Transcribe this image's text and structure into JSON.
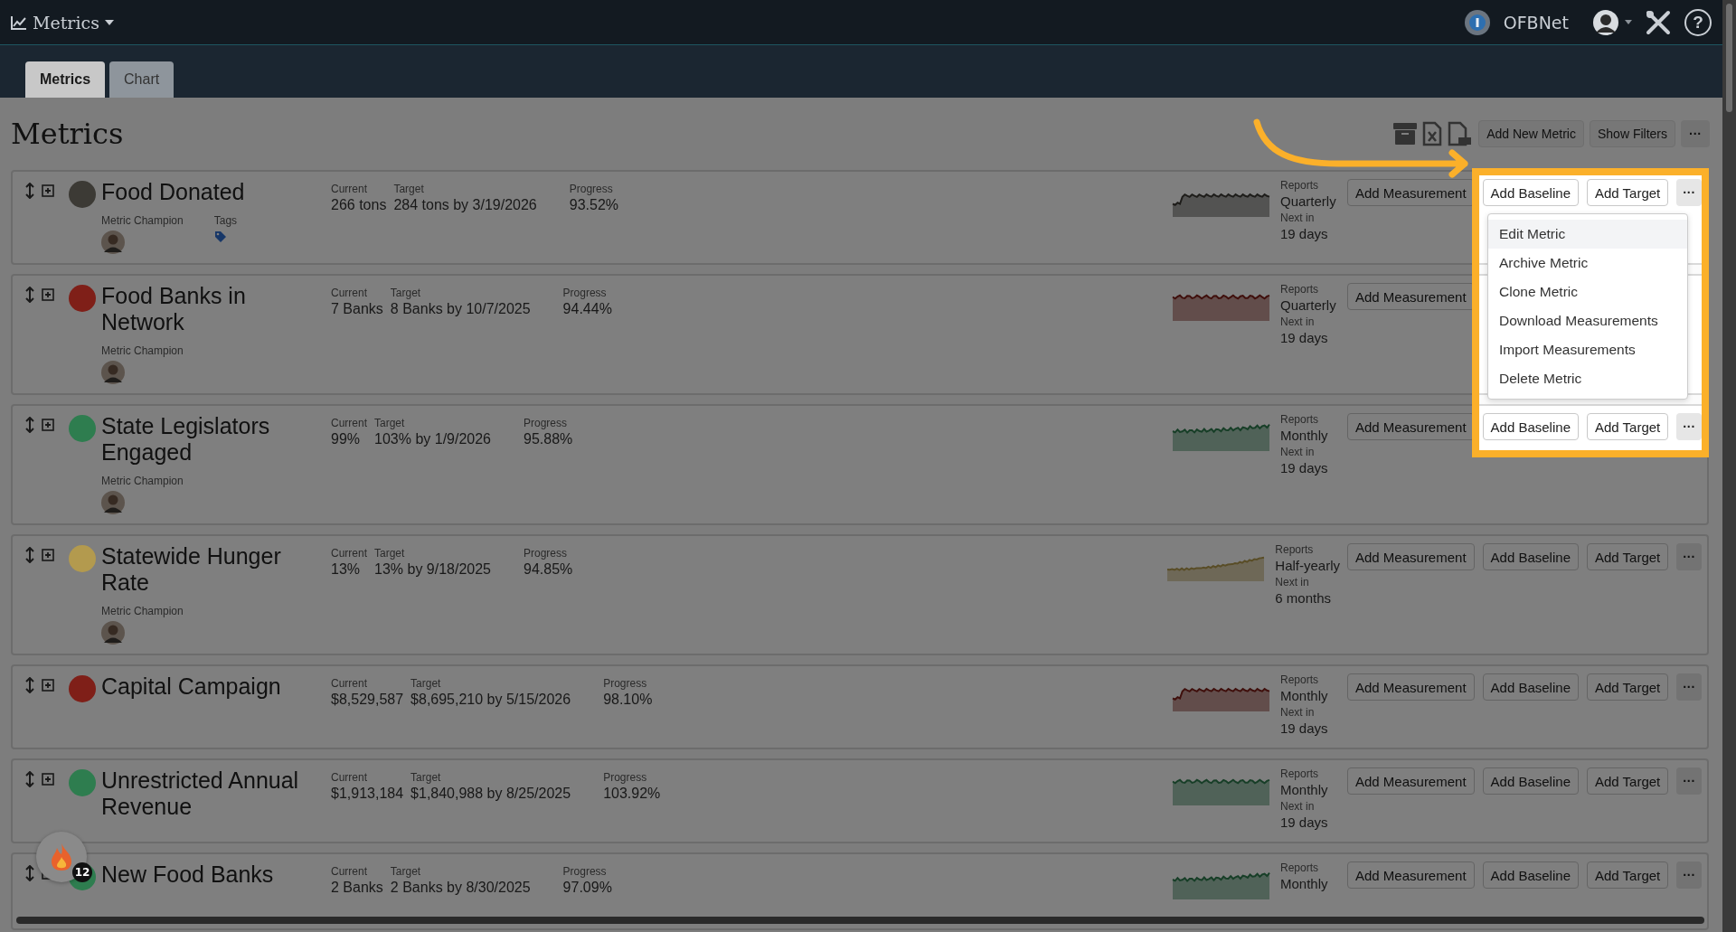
{
  "header": {
    "app_title": "Metrics",
    "org_name": "OFBNet",
    "help": "?"
  },
  "tabs": [
    {
      "label": "Metrics",
      "selected": true
    },
    {
      "label": "Chart",
      "selected": false
    }
  ],
  "page_title": "Metrics",
  "toolbar": {
    "buttons": [
      "Add New Metric",
      "Show Filters"
    ],
    "more": "···"
  },
  "metrics": [
    {
      "name": "Food Donated",
      "color": "#3c3a35",
      "current_label": "Current",
      "current": "266 tons",
      "target_label": "Target",
      "target": "284 tons by 3/19/2026",
      "progress_label": "Progress",
      "progress": "93.52%",
      "champion_label": "Metric Champion",
      "tags_label": "Tags",
      "reports_label": "Reports",
      "reports": "Quarterly",
      "next_label": "Next in",
      "next": "19 days",
      "actions": [
        "Add Measurement",
        "Add Baseline",
        "Add Target"
      ],
      "more": "···"
    },
    {
      "name": "Food Banks in Network",
      "color": "#7f1f18",
      "current_label": "Current",
      "current": "7 Banks",
      "target_label": "Target",
      "target": "8 Banks by 10/7/2025",
      "progress_label": "Progress",
      "progress": "94.44%",
      "champion_label": "Metric Champion",
      "reports_label": "Reports",
      "reports": "Quarterly",
      "next_label": "Next in",
      "next": "19 days",
      "actions": [
        "Add Measurement"
      ]
    },
    {
      "name": "State Legislators Engaged",
      "color": "#2e7d4f",
      "current_label": "Current",
      "current": "99%",
      "target_label": "Target",
      "target": "103% by 1/9/2026",
      "progress_label": "Progress",
      "progress": "95.88%",
      "champion_label": "Metric Champion",
      "reports_label": "Reports",
      "reports": "Monthly",
      "next_label": "Next in",
      "next": "19 days",
      "actions": [
        "Add Measurement",
        "Add Baseline",
        "Add Target"
      ],
      "more": "···"
    },
    {
      "name": "Statewide Hunger Rate",
      "color": "#b39a4e",
      "current_label": "Current",
      "current": "13%",
      "target_label": "Target",
      "target": "13% by 9/18/2025",
      "progress_label": "Progress",
      "progress": "94.85%",
      "champion_label": "Metric Champion",
      "reports_label": "Reports",
      "reports": "Half-yearly",
      "next_label": "Next in",
      "next": "6 months",
      "actions": [
        "Add Measurement",
        "Add Baseline",
        "Add Target"
      ],
      "more": "···"
    },
    {
      "name": "Capital Campaign",
      "color": "#7f1f18",
      "current_label": "Current",
      "current": "$8,529,587",
      "target_label": "Target",
      "target": "$8,695,210 by 5/15/2026",
      "progress_label": "Progress",
      "progress": "98.10%",
      "reports_label": "Reports",
      "reports": "Monthly",
      "next_label": "Next in",
      "next": "19 days",
      "actions": [
        "Add Measurement",
        "Add Baseline",
        "Add Target"
      ],
      "more": "···"
    },
    {
      "name": "Unrestricted Annual Revenue",
      "color": "#2e7d4f",
      "current_label": "Current",
      "current": "$1,913,184",
      "target_label": "Target",
      "target": "$1,840,988 by 8/25/2025",
      "progress_label": "Progress",
      "progress": "103.92%",
      "reports_label": "Reports",
      "reports": "Monthly",
      "next_label": "Next in",
      "next": "19 days",
      "actions": [
        "Add Measurement",
        "Add Baseline",
        "Add Target"
      ],
      "more": "···"
    },
    {
      "name": "New Food Banks",
      "color": "#2e7d4f",
      "current_label": "Current",
      "current": "2 Banks",
      "target_label": "Target",
      "target": "2 Banks by 8/30/2025",
      "progress_label": "Progress",
      "progress": "97.09%",
      "reports_label": "Reports",
      "reports": "Monthly",
      "actions": [
        "Add Measurement",
        "Add Baseline",
        "Add Target"
      ],
      "more": "···"
    }
  ],
  "row_menu": {
    "items": [
      {
        "label": "Edit Metric",
        "hovered": true
      },
      {
        "label": "Archive Metric",
        "hovered": false
      },
      {
        "label": "Clone Metric",
        "hovered": false
      },
      {
        "label": "Download Measurements",
        "hovered": false
      },
      {
        "label": "Import Measurements",
        "hovered": false
      },
      {
        "label": "Delete Metric",
        "hovered": false
      }
    ]
  },
  "notification_badge": {
    "count": "12"
  }
}
